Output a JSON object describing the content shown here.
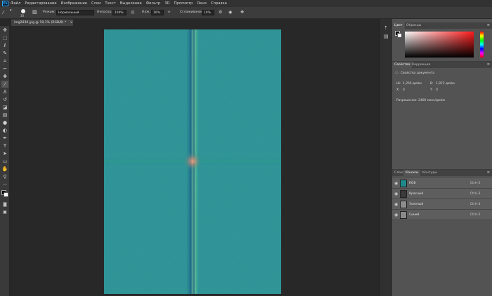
{
  "app": {
    "logo": "Ps",
    "menu": [
      "Файл",
      "Редактирование",
      "Изображение",
      "Слои",
      "Текст",
      "Выделение",
      "Фильтр",
      "3D",
      "Просмотр",
      "Окно",
      "Справка"
    ]
  },
  "options": {
    "brush_size": "30",
    "mode_label": "Режим:",
    "mode_value": "Нормальный",
    "opacity_label": "Непрозр.:",
    "opacity_value": "100%",
    "flow_label": "Наж.:",
    "flow_value": "10%",
    "smoothing_label": "Сглаживание:",
    "smoothing_value": "10%"
  },
  "document": {
    "tab_title": "img2830.jpg @ 19,1% (RGB/8) *",
    "tab_close": "×"
  },
  "color_panel": {
    "tabs": [
      "Цвет",
      "Образцы"
    ],
    "hue_color": "#ff1b1b"
  },
  "properties_panel": {
    "tabs": [
      "Свойства",
      "Коррекция"
    ],
    "heading": "Свойства документа",
    "w_label": "Ш:",
    "w_value": "1,256 дюйм",
    "h_label": "В:",
    "h_value": "1,973 дюйм",
    "x_label": "X:",
    "x_value": "0",
    "y_label": "Y:",
    "y_value": "0",
    "resolution": "Разрешение: 2400 пикс/дюйм"
  },
  "channels_panel": {
    "tabs": [
      "Слои",
      "Каналы",
      "Контуры"
    ],
    "channels": [
      {
        "name": "RGB",
        "shortcut": "Ctrl+2",
        "color": "#1f8a8c"
      },
      {
        "name": "Красный",
        "shortcut": "Ctrl+3",
        "color": "#3a3a3a"
      },
      {
        "name": "Зеленый",
        "shortcut": "Ctrl+4",
        "color": "#8c8c8c"
      },
      {
        "name": "Синий",
        "shortcut": "Ctrl+5",
        "color": "#8a8a8a"
      }
    ]
  },
  "colors": {
    "image_base": "#248c8e",
    "accent_panel": "#535353"
  }
}
